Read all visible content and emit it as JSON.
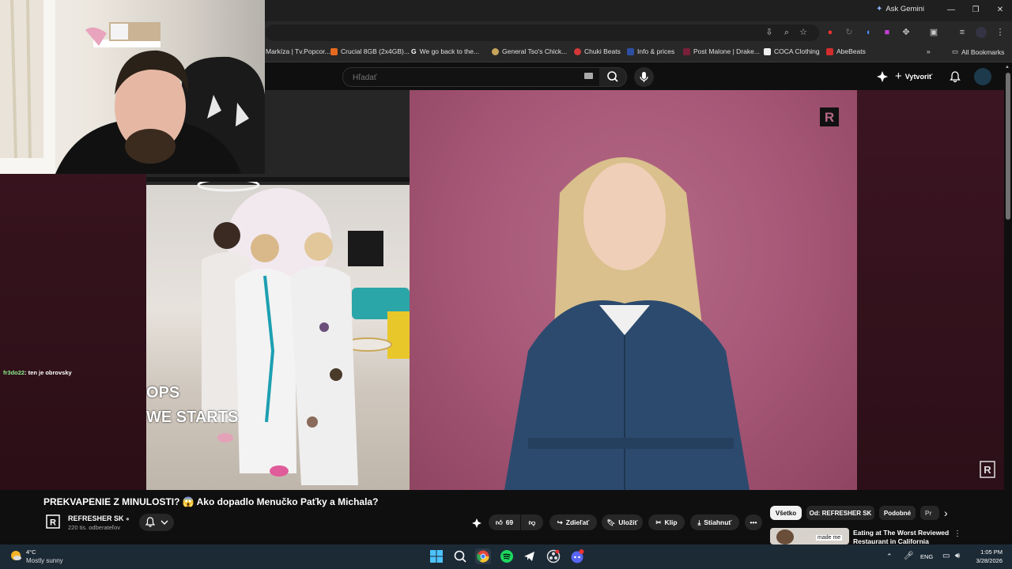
{
  "browser": {
    "ask_gemini": "Ask Gemini",
    "bookmarks": [
      {
        "label": "Markíza | Tv.Popcor...",
        "color": "#3a3a3a"
      },
      {
        "label": "Crucial 8GB (2x4GB)...",
        "color": "#e56a1f"
      },
      {
        "label": "We go back to the...",
        "color": "#4285f4"
      },
      {
        "label": "General Tso's Chick...",
        "color": "#c7a45a"
      },
      {
        "label": "Chuki Beats",
        "color": "#d33838"
      },
      {
        "label": "Info & prices",
        "color": "#2d4fa3"
      },
      {
        "label": "Post Malone | Drake...",
        "color": "#7a1f3a"
      },
      {
        "label": "COCA Clothing",
        "color": "#222222"
      },
      {
        "label": "AbeBeats",
        "color": "#d12d2d"
      }
    ],
    "all_bookmarks": "All Bookmarks"
  },
  "youtube": {
    "search_placeholder": "Hľadať",
    "create_label": "Vytvoriť",
    "chat_user": "fr3do22",
    "chat_message": ": ten je obrovsky",
    "photo_caption_1": "OPS",
    "photo_caption_2": "WE STARTS",
    "video_title": "PREKVAPENIE Z MINULOSTI? 😱 Ako dopadlo Menučko Paťky a Michala?",
    "channel_name": "REFRESHER SK",
    "subscribers": "220 tis. odberateľov",
    "likes": "69",
    "share_label": "Zdieľať",
    "save_label": "Uložiť",
    "clip_label": "Klip",
    "download_label": "Stiahnuť",
    "chips": [
      "Všetko",
      "Od: REFRESHER SK",
      "Podobné",
      "Pr"
    ],
    "rec_title_1": "Eating at The Worst Reviewed",
    "rec_title_2": "Restaurant in California",
    "rec_thumb_text_1": "made me",
    "accent": "#ff0000"
  },
  "taskbar": {
    "weather_temp": "4°C",
    "weather_desc": "Mostly sunny",
    "lang": "ENG",
    "time": "1:05 PM",
    "date": "3/28/2026"
  }
}
